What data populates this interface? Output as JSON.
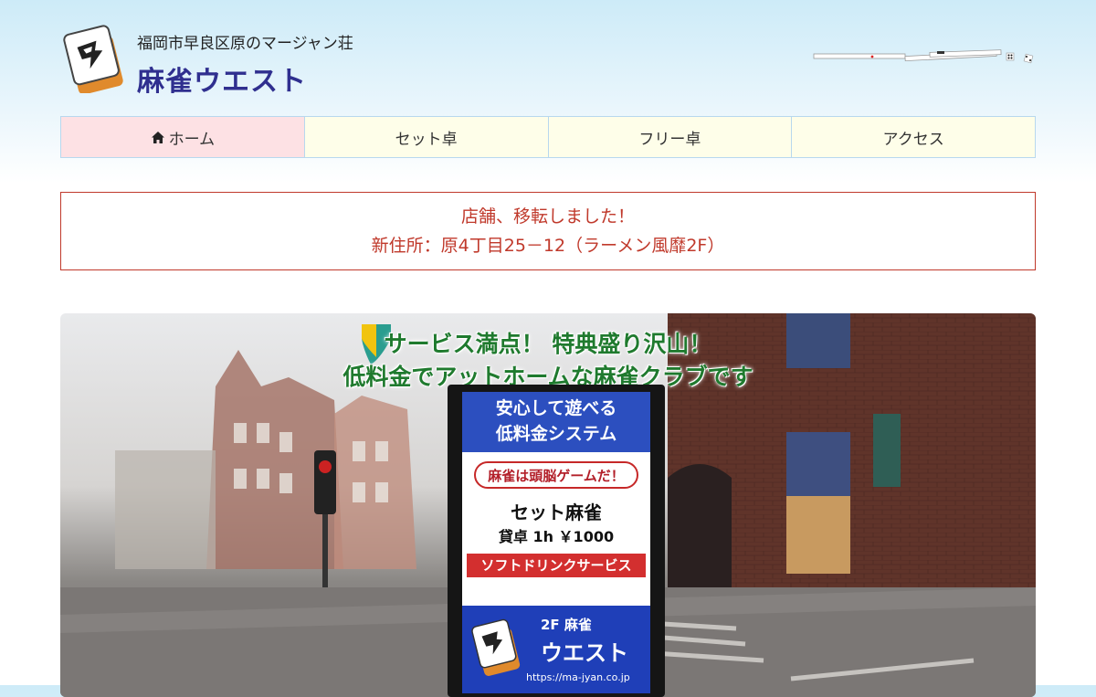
{
  "header": {
    "tagline": "福岡市早良区原のマージャン荘",
    "title": "麻雀ウエスト"
  },
  "nav": {
    "items": [
      {
        "label": "ホーム",
        "icon": "home-icon"
      },
      {
        "label": "セット卓"
      },
      {
        "label": "フリー卓"
      },
      {
        "label": "アクセス"
      }
    ]
  },
  "notice": {
    "line1": "店舗、移転しました！",
    "line2": "新住所：原4丁目25－12（ラーメン風靡2F）"
  },
  "hero": {
    "catch_line1": "サービス満点！ 特典盛り沢山！",
    "catch_line2": "低料金でアットホームな麻雀クラブです",
    "board": {
      "top_line1": "安心して遊べる",
      "top_line2": "低料金システム",
      "badge": "麻雀は頭脳ゲームだ！",
      "set_title": "セット麻雀",
      "price": "貸卓 1h ￥1000",
      "drink": "ソフトドリンクサービス",
      "floor": "2F 麻雀",
      "name": "ウエスト",
      "url": "https://ma-jyan.co.jp"
    }
  },
  "colors": {
    "title": "#2f2f8f",
    "notice": "#c0392b",
    "nav_active": "#fde1e4",
    "nav_bg": "#fefee9",
    "catch": "#1f7a2e"
  }
}
